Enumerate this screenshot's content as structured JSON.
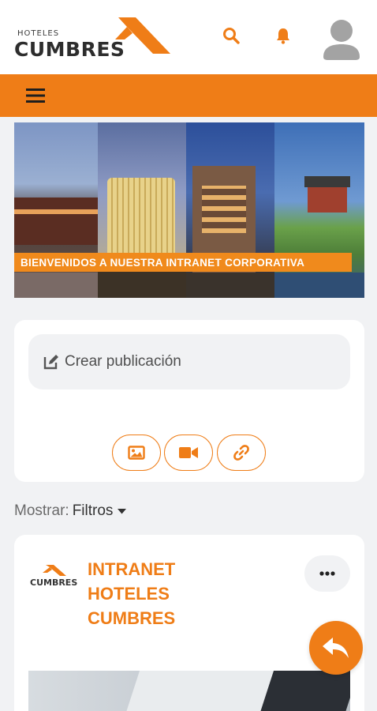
{
  "header": {
    "logo_small": "HOTELES",
    "logo_big": "CUMBRES",
    "icons": [
      "search-icon",
      "bell-icon",
      "user-avatar-icon"
    ],
    "accent": "#ef7d17"
  },
  "nav": {
    "menu_icon": "hamburger-icon"
  },
  "banner": {
    "caption": "BIENVENIDOS A NUESTRA INTRANET CORPORATIVA"
  },
  "composer": {
    "create_label": "Crear publicación",
    "attachments": [
      "image-icon",
      "video-icon",
      "link-icon"
    ]
  },
  "filter": {
    "label": "Mostrar:",
    "value": "Filtros"
  },
  "post": {
    "logo_text": "CUMBRES",
    "title": "INTRANET HOTELES CUMBRES",
    "more_icon": "ellipsis-icon"
  },
  "fab": {
    "icon": "reply-icon"
  }
}
